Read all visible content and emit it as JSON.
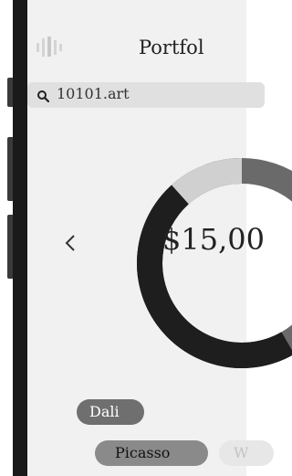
{
  "header": {
    "title": "Portfol",
    "logo_icon": "soundwave-logo-icon"
  },
  "search": {
    "query": "10101.art",
    "icon": "search-icon"
  },
  "portfolio": {
    "value_text": "$15,00"
  },
  "nav": {
    "prev_icon": "chevron-left-icon"
  },
  "chips": [
    {
      "label": "Dali",
      "state": "selected"
    },
    {
      "label": "Picasso",
      "state": "selected"
    },
    {
      "label": "W",
      "state": "unselected"
    }
  ],
  "chart_data": {
    "type": "pie",
    "segment_colors": [
      "#1e1e1e",
      "#d0d0d0",
      "#6a6a6a"
    ]
  }
}
